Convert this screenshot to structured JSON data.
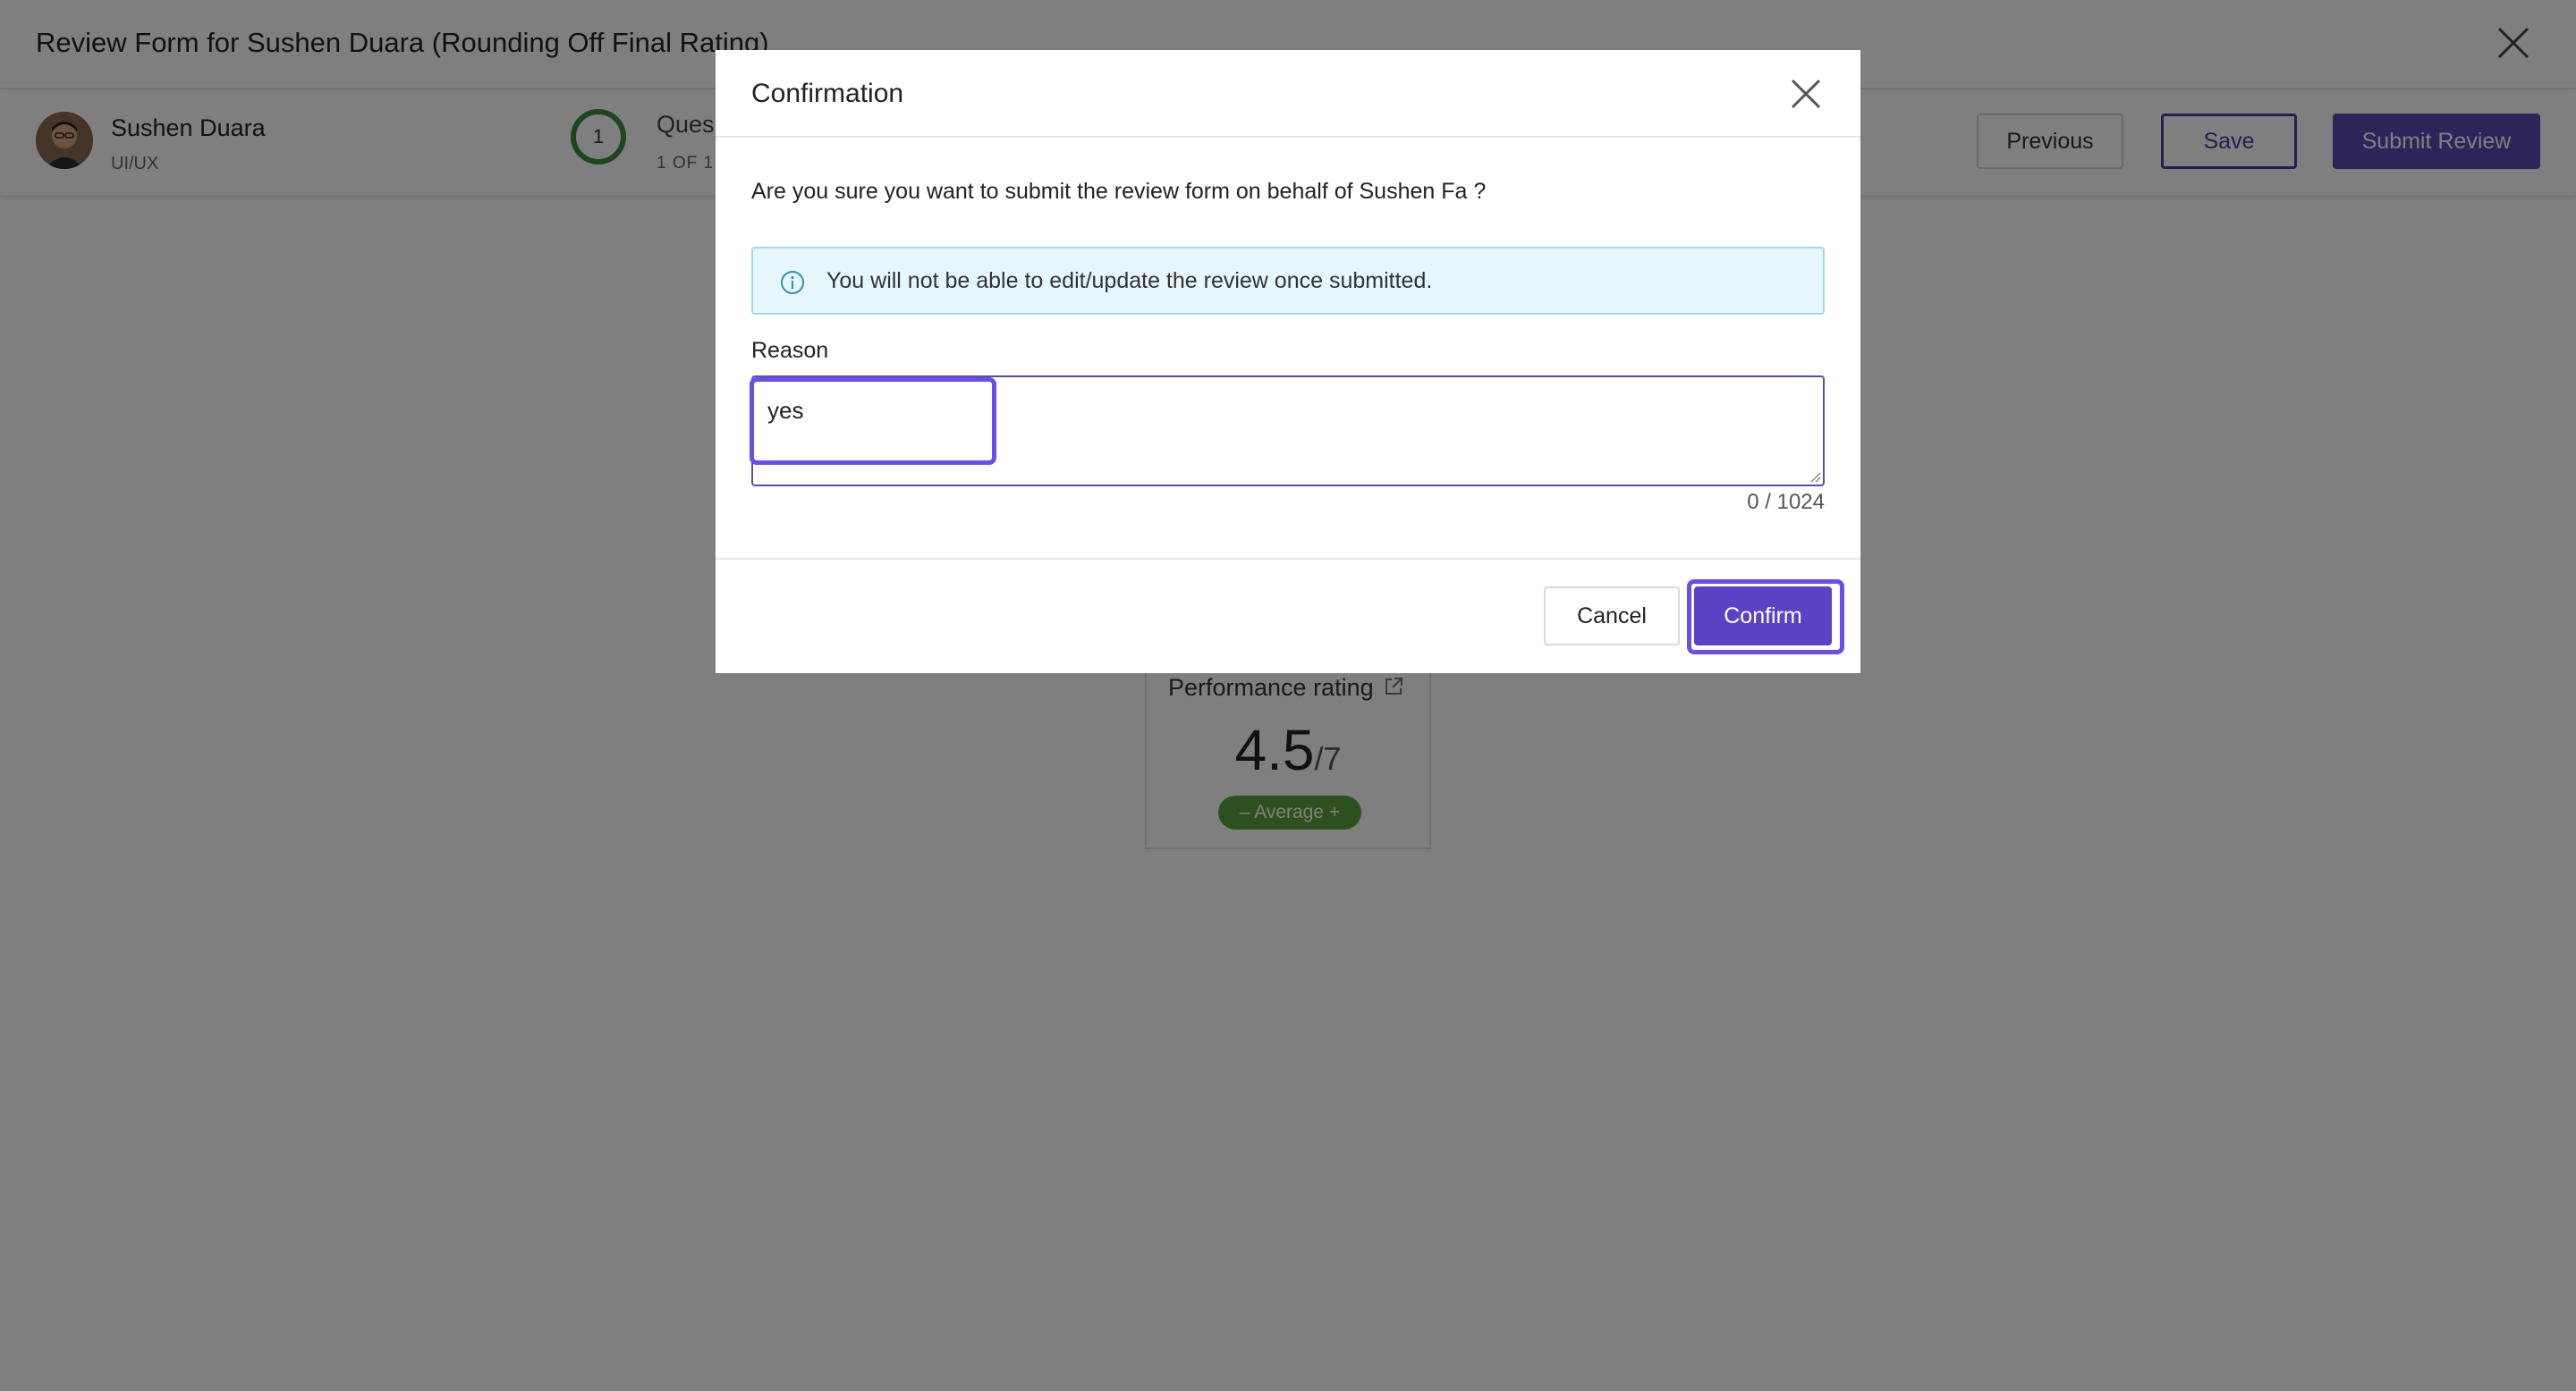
{
  "page": {
    "title": "Review Form for Sushen Duara (Rounding Off Final Rating)"
  },
  "employee": {
    "name": "Sushen Duara",
    "role": "UI/UX"
  },
  "progress": {
    "number": "1",
    "label": "Ques",
    "sub": "1 OF 1"
  },
  "actions": {
    "previous": "Previous",
    "save": "Save",
    "submit": "Submit Review"
  },
  "rating": {
    "label": "Performance rating",
    "value": "4.5",
    "denominator": "/7",
    "badge": "– Average +"
  },
  "modal": {
    "title": "Confirmation",
    "question": "Are you sure you want to submit the review form on behalf of Sushen Fa ?",
    "info": "You will not be able to edit/update the review once submitted.",
    "reason_label": "Reason",
    "reason_value": "yes",
    "char_count": "0 / 1024",
    "cancel": "Cancel",
    "confirm": "Confirm"
  },
  "icons": {
    "close": "close-icon",
    "info": "info-icon",
    "external_link": "external-link-icon"
  },
  "colors": {
    "accent": "#5b42c4",
    "highlight": "#6c4dea",
    "info_bg": "#e6f7fd",
    "badge_green": "#5aa33d"
  }
}
